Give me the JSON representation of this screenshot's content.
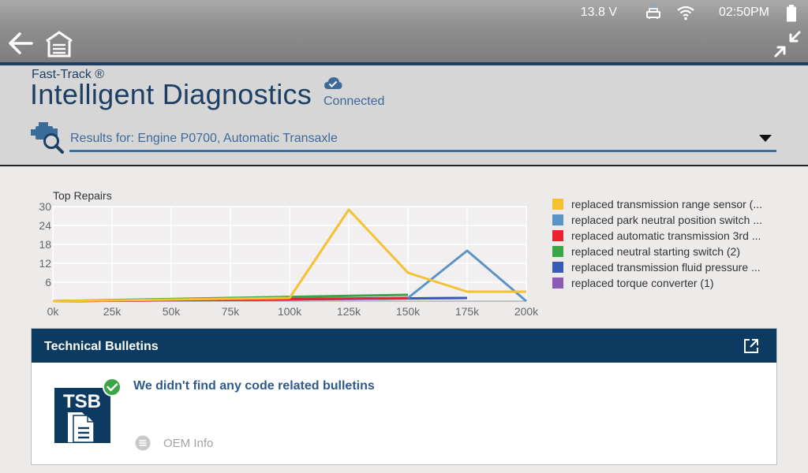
{
  "status_bar": {
    "voltage": "13.8 V",
    "time": "02:50PM",
    "icons": [
      "vehicle-connector-icon",
      "wifi-icon",
      "battery-icon"
    ]
  },
  "toolbar": {
    "icons": [
      "back-arrow-icon",
      "home-icon",
      "exit-fullscreen-icon"
    ]
  },
  "header": {
    "brand_small": "Fast-Track ®",
    "brand_big": "Intelligent Diagnostics",
    "connection_status": "Connected",
    "results_select": "Results for: Engine  P0700, Automatic Transaxle"
  },
  "colors": {
    "navy": "#0d3a61",
    "accent_blue": "#3a6da6",
    "yellow": "#f5c032",
    "light_blue": "#5b93c7",
    "red": "#e8222e",
    "green": "#3aa547",
    "dark_blue": "#3a5bb5",
    "purple": "#8a5bb5"
  },
  "chart_data": {
    "type": "line",
    "title": "Top Repairs",
    "x": [
      0,
      25,
      50,
      75,
      100,
      125,
      150,
      175,
      200
    ],
    "x_tick_labels": [
      "0k",
      "25k",
      "50k",
      "75k",
      "100k",
      "125k",
      "150k",
      "175k",
      "200k"
    ],
    "y_ticks": [
      6,
      12,
      18,
      24,
      30
    ],
    "ylim": [
      0,
      30
    ],
    "xlim": [
      0,
      200
    ],
    "grid": true,
    "legend_position": "right",
    "series": [
      {
        "name": "replaced transmission range sensor (...",
        "color": "#f5c032",
        "points": [
          [
            0,
            0
          ],
          [
            100,
            1
          ],
          [
            125,
            29
          ],
          [
            150,
            9
          ],
          [
            175,
            3
          ],
          [
            200,
            3
          ]
        ]
      },
      {
        "name": "replaced park neutral position switch ...",
        "color": "#5b93c7",
        "points": [
          [
            150,
            1
          ],
          [
            175,
            16
          ],
          [
            200,
            0
          ]
        ]
      },
      {
        "name": "replaced automatic transmission 3rd ...",
        "color": "#e8222e",
        "points": [
          [
            0,
            0
          ],
          [
            150,
            1
          ]
        ]
      },
      {
        "name": "replaced neutral starting switch (2)",
        "color": "#3aa547",
        "points": [
          [
            0,
            0
          ],
          [
            150,
            2
          ]
        ]
      },
      {
        "name": "replaced transmission fluid pressure ...",
        "color": "#3a5bb5",
        "points": [
          [
            0,
            0
          ],
          [
            175,
            1
          ]
        ]
      },
      {
        "name": "replaced torque converter (1)",
        "color": "#8a5bb5",
        "points": [
          [
            0,
            0
          ],
          [
            175,
            1
          ]
        ]
      }
    ]
  },
  "bulletins": {
    "title": "Technical Bulletins",
    "message": "We didn't find any code related bulletins",
    "tsb_label": "TSB",
    "oem_info": "OEM Info"
  }
}
